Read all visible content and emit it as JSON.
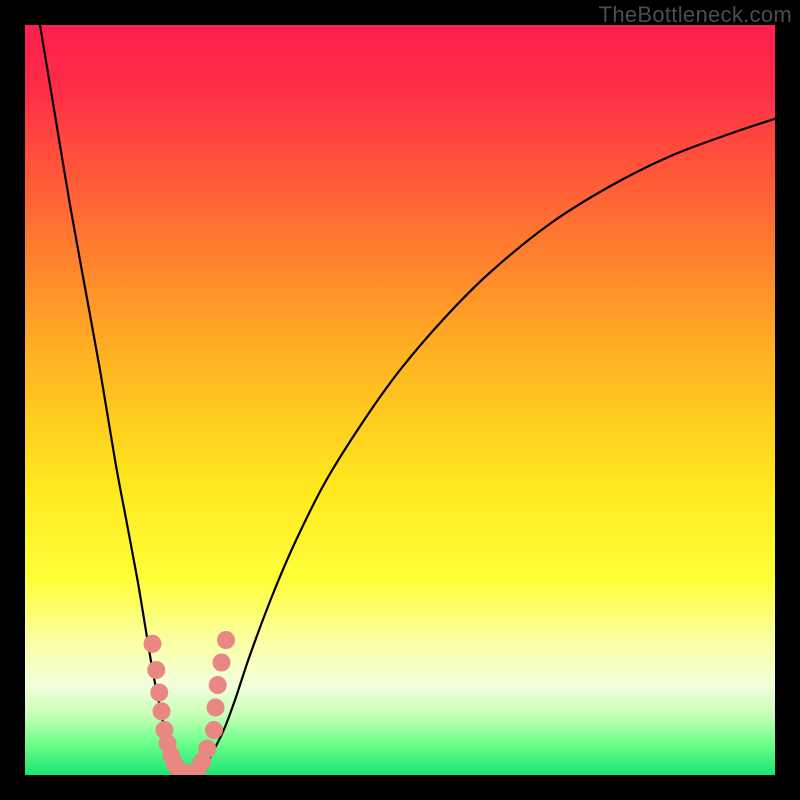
{
  "watermark": "TheBottleneck.com",
  "chart_data": {
    "type": "line",
    "title": "",
    "xlabel": "",
    "ylabel": "",
    "xlim": [
      0,
      100
    ],
    "ylim": [
      0,
      100
    ],
    "gradient_stops": [
      {
        "offset": 0,
        "color": "#ff1f4e"
      },
      {
        "offset": 0.08,
        "color": "#ff2b47"
      },
      {
        "offset": 0.25,
        "color": "#ff6b33"
      },
      {
        "offset": 0.45,
        "color": "#ffb522"
      },
      {
        "offset": 0.62,
        "color": "#ffe91e"
      },
      {
        "offset": 0.74,
        "color": "#ffff3a"
      },
      {
        "offset": 0.82,
        "color": "#fbffa1"
      },
      {
        "offset": 0.88,
        "color": "#f2ffdd"
      },
      {
        "offset": 0.92,
        "color": "#c8ffb7"
      },
      {
        "offset": 0.96,
        "color": "#66ff87"
      },
      {
        "offset": 1.0,
        "color": "#19e472"
      }
    ],
    "series": [
      {
        "name": "left-branch",
        "x": [
          2,
          4,
          6,
          8,
          10,
          12,
          13.5,
          15,
          16,
          17,
          17.8,
          18.4,
          18.9,
          19.3,
          19.6,
          19.9,
          20.2,
          20.4
        ],
        "y": [
          100,
          88,
          76,
          65,
          54,
          42,
          34,
          26,
          20,
          14,
          10,
          7,
          4.5,
          3,
          2,
          1.2,
          0.6,
          0.3
        ]
      },
      {
        "name": "valley-floor",
        "x": [
          20.4,
          20.8,
          21.3,
          21.8,
          22.3,
          22.8,
          23.2
        ],
        "y": [
          0.3,
          0.15,
          0.1,
          0.1,
          0.12,
          0.2,
          0.35
        ]
      },
      {
        "name": "right-branch",
        "x": [
          23.2,
          24,
          25,
          26.5,
          28,
          30,
          33,
          36,
          40,
          45,
          50,
          56,
          62,
          70,
          78,
          86,
          94,
          100
        ],
        "y": [
          0.35,
          1.2,
          3,
          6,
          10,
          16,
          24,
          31,
          39,
          47,
          54,
          61,
          67,
          73.5,
          78.5,
          82.5,
          85.5,
          87.5
        ]
      }
    ],
    "markers": [
      {
        "x": 17.0,
        "y": 17.5
      },
      {
        "x": 17.5,
        "y": 14.0
      },
      {
        "x": 17.9,
        "y": 11.0
      },
      {
        "x": 18.2,
        "y": 8.5
      },
      {
        "x": 18.6,
        "y": 6.0
      },
      {
        "x": 19.0,
        "y": 4.2
      },
      {
        "x": 19.5,
        "y": 2.6
      },
      {
        "x": 20.0,
        "y": 1.4
      },
      {
        "x": 20.6,
        "y": 0.6
      },
      {
        "x": 21.2,
        "y": 0.25
      },
      {
        "x": 21.8,
        "y": 0.2
      },
      {
        "x": 22.4,
        "y": 0.3
      },
      {
        "x": 23.0,
        "y": 0.7
      },
      {
        "x": 23.6,
        "y": 1.8
      },
      {
        "x": 24.3,
        "y": 3.5
      },
      {
        "x": 25.2,
        "y": 6.0
      },
      {
        "x": 25.4,
        "y": 9.0
      },
      {
        "x": 25.7,
        "y": 12.0
      },
      {
        "x": 26.2,
        "y": 15.0
      },
      {
        "x": 26.8,
        "y": 18.0
      }
    ],
    "marker_color": "#e98782",
    "curve_color": "#000000"
  }
}
